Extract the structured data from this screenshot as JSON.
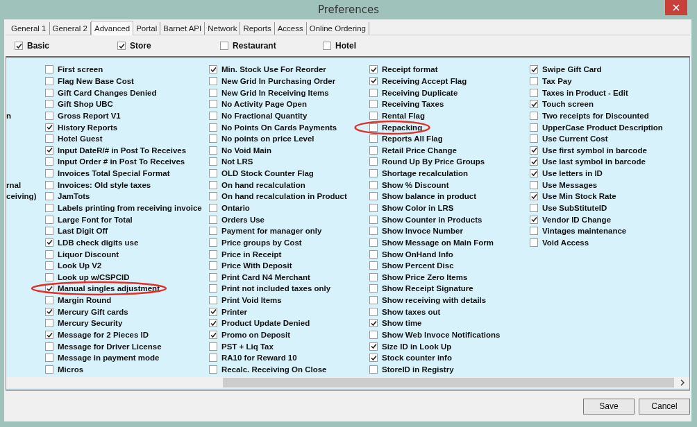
{
  "window": {
    "title": "Preferences"
  },
  "tabs": [
    {
      "label": "General 1",
      "selected": false
    },
    {
      "label": "General 2",
      "selected": false
    },
    {
      "label": "Advanced",
      "selected": true
    },
    {
      "label": "Portal",
      "selected": false
    },
    {
      "label": "Barnet API",
      "selected": false
    },
    {
      "label": "Network",
      "selected": false
    },
    {
      "label": "Reports",
      "selected": false
    },
    {
      "label": "Access",
      "selected": false
    },
    {
      "label": "Online Ordering",
      "selected": false
    }
  ],
  "modes": [
    {
      "label": "Basic",
      "checked": true
    },
    {
      "label": "Store",
      "checked": true
    },
    {
      "label": "Restaurant",
      "checked": false
    },
    {
      "label": "Hotel",
      "checked": false
    }
  ],
  "columns": [
    [
      {
        "label": "First screen",
        "checked": false
      },
      {
        "label": "Flag New Base Cost",
        "checked": false
      },
      {
        "label": "Gift Card Changes Denied",
        "checked": false
      },
      {
        "label": "Gift Shop UBC",
        "checked": false
      },
      {
        "label": "Gross Report V1",
        "checked": false,
        "cut_left": "n"
      },
      {
        "label": "History Reports",
        "checked": true
      },
      {
        "label": "Hotel Guest",
        "checked": false
      },
      {
        "label": "Input DateR/# in Post To Receives",
        "checked": true
      },
      {
        "label": "Input Order # in Post To Receives",
        "checked": false
      },
      {
        "label": "Invoices Total Special Format",
        "checked": false
      },
      {
        "label": "Invoices: Old style taxes",
        "checked": false,
        "cut_left": "rnal"
      },
      {
        "label": "JamTots",
        "checked": false,
        "cut_left": "ceiving)"
      },
      {
        "label": "Labels printing from receiving invoice",
        "checked": false
      },
      {
        "label": "Large Font for Total",
        "checked": false
      },
      {
        "label": "Last Digit Off",
        "checked": false
      },
      {
        "label": "LDB check digits use",
        "checked": true
      },
      {
        "label": "Liquor Discount",
        "checked": false
      },
      {
        "label": "Look Up V2",
        "checked": false
      },
      {
        "label": "Look up w/CSPCID",
        "checked": false
      },
      {
        "label": "Manual singles adjustment",
        "checked": true,
        "circled": true
      },
      {
        "label": "Margin Round",
        "checked": false
      },
      {
        "label": "Mercury Gift cards",
        "checked": true
      },
      {
        "label": "Mercury Security",
        "checked": false
      },
      {
        "label": "Message for 2 Pieces ID",
        "checked": true
      },
      {
        "label": "Message for Driver License",
        "checked": false
      },
      {
        "label": "Message in payment mode",
        "checked": false
      },
      {
        "label": "Micros",
        "checked": false
      }
    ],
    [
      {
        "label": "Min. Stock Use For Reorder",
        "checked": true
      },
      {
        "label": "New Grid In Purchasing Order",
        "checked": false
      },
      {
        "label": "New Grid In Receiving Items",
        "checked": false
      },
      {
        "label": "No Activity Page Open",
        "checked": false
      },
      {
        "label": "No Fractional Quantity",
        "checked": false
      },
      {
        "label": "No Points On Cards Payments",
        "checked": false
      },
      {
        "label": "No points on price Level",
        "checked": false
      },
      {
        "label": "No Void Main",
        "checked": false
      },
      {
        "label": "Not LRS",
        "checked": false
      },
      {
        "label": "OLD Stock Counter Flag",
        "checked": false
      },
      {
        "label": "On hand recalculation",
        "checked": false
      },
      {
        "label": "On hand recalculation in Product",
        "checked": false
      },
      {
        "label": "Ontario",
        "checked": false
      },
      {
        "label": "Orders Use",
        "checked": false
      },
      {
        "label": "Payment for manager only",
        "checked": false
      },
      {
        "label": "Price groups by Cost",
        "checked": false
      },
      {
        "label": "Price in Receipt",
        "checked": false
      },
      {
        "label": "Price With Deposit",
        "checked": false
      },
      {
        "label": "Print Card N4 Merchant",
        "checked": false
      },
      {
        "label": "Print not included taxes only",
        "checked": false
      },
      {
        "label": "Print Void Items",
        "checked": false
      },
      {
        "label": "Printer",
        "checked": true
      },
      {
        "label": "Product Update Denied",
        "checked": true
      },
      {
        "label": "Promo on Deposit",
        "checked": true
      },
      {
        "label": "PST + Liq Tax",
        "checked": false
      },
      {
        "label": "RA10 for Reward 10",
        "checked": false
      },
      {
        "label": "Recalc. Receiving On Close",
        "checked": false
      }
    ],
    [
      {
        "label": "Receipt format",
        "checked": true
      },
      {
        "label": "Receiving Accept Flag",
        "checked": true
      },
      {
        "label": "Receiving Duplicate",
        "checked": false
      },
      {
        "label": "Receiving Taxes",
        "checked": false
      },
      {
        "label": "Rental Flag",
        "checked": false
      },
      {
        "label": "Repacking",
        "checked": false,
        "circled": true
      },
      {
        "label": "Reports All Flag",
        "checked": false
      },
      {
        "label": "Retail Price Change",
        "checked": false
      },
      {
        "label": "Round Up By Price Groups",
        "checked": false
      },
      {
        "label": "Shortage recalculation",
        "checked": false
      },
      {
        "label": "Show % Discount",
        "checked": false
      },
      {
        "label": "Show balance in product",
        "checked": false
      },
      {
        "label": "Show Color in LRS",
        "checked": false
      },
      {
        "label": "Show Counter in Products",
        "checked": false
      },
      {
        "label": "Show Invoce Number",
        "checked": false
      },
      {
        "label": "Show Message on Main Form",
        "checked": false
      },
      {
        "label": "Show OnHand Info",
        "checked": false
      },
      {
        "label": "Show Percent Disc",
        "checked": false
      },
      {
        "label": "Show Price Zero Items",
        "checked": false
      },
      {
        "label": "Show Receipt Signature",
        "checked": false
      },
      {
        "label": "Show receiving with details",
        "checked": false
      },
      {
        "label": "Show taxes out",
        "checked": false
      },
      {
        "label": "Show time",
        "checked": true
      },
      {
        "label": "Show Web Invoce Notifications",
        "checked": false
      },
      {
        "label": "Size ID in Look Up",
        "checked": true
      },
      {
        "label": "Stock counter info",
        "checked": true
      },
      {
        "label": "StoreID in Registry",
        "checked": false
      }
    ],
    [
      {
        "label": "Swipe Gift Card",
        "checked": true
      },
      {
        "label": "Tax Pay",
        "checked": false
      },
      {
        "label": "Taxes in Product - Edit",
        "checked": false
      },
      {
        "label": "Touch screen",
        "checked": true
      },
      {
        "label": "Two receipts for Discounted",
        "checked": false
      },
      {
        "label": "UpperCase Product Description",
        "checked": false
      },
      {
        "label": "Use Current Cost",
        "checked": false
      },
      {
        "label": "Use first symbol in barcode",
        "checked": true
      },
      {
        "label": "Use last symbol in barcode",
        "checked": true
      },
      {
        "label": "Use letters in ID",
        "checked": true
      },
      {
        "label": "Use Messages",
        "checked": false
      },
      {
        "label": "Use Min Stock Rate",
        "checked": true
      },
      {
        "label": "Use SubStituteID",
        "checked": false
      },
      {
        "label": "Vendor ID Change",
        "checked": true
      },
      {
        "label": "Vintages maintenance",
        "checked": false
      },
      {
        "label": "Void Access",
        "checked": false
      }
    ]
  ],
  "buttons": [
    "Save",
    "Cancel"
  ]
}
